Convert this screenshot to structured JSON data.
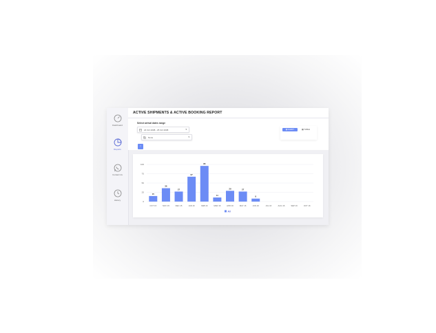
{
  "sidebar": {
    "items": [
      {
        "label": "Dashboard",
        "icon": "speedometer-icon"
      },
      {
        "label": "Reports",
        "icon": "pie-chart-icon",
        "active": true
      },
      {
        "label": "Contact Us",
        "icon": "whatsapp-icon"
      },
      {
        "label": "History",
        "icon": "clock-icon"
      }
    ]
  },
  "header": {
    "title": "ACTIVE SHIPMENTS & ACTIVE BOOKING REPORT"
  },
  "controls": {
    "range_label": "Select arrival dates range",
    "date_range": "24 Oct 2008 - 25 Oct 2008",
    "group_value": "None",
    "chart_label": "CHART",
    "table_label": "TABLE",
    "up_icon": "arrow-up-icon"
  },
  "colors": {
    "accent": "#6c8cf5",
    "bar": "#6c8cf5"
  },
  "chart_data": {
    "type": "bar",
    "categories": [
      "OCT 15",
      "NOV 15",
      "DEC 15",
      "JAN 16",
      "FEB 16",
      "MAR 16",
      "APR 16",
      "MAY 16",
      "JUN 16",
      "JUL 16",
      "AUG 16",
      "SEP 16",
      "OCT 16"
    ],
    "series": [
      {
        "name": "All",
        "values": [
          15,
          36,
          27,
          67,
          96,
          11,
          29,
          27,
          8,
          0,
          0,
          0,
          0
        ]
      }
    ],
    "value_labels": [
      "15",
      "36",
      "27",
      "67",
      "96",
      "11",
      "29",
      "27",
      "8",
      "",
      "",
      "",
      ""
    ],
    "yticks": [
      0,
      25,
      50,
      75,
      100
    ],
    "ylim": [
      0,
      100
    ],
    "grid": true,
    "legend": "bottom"
  }
}
